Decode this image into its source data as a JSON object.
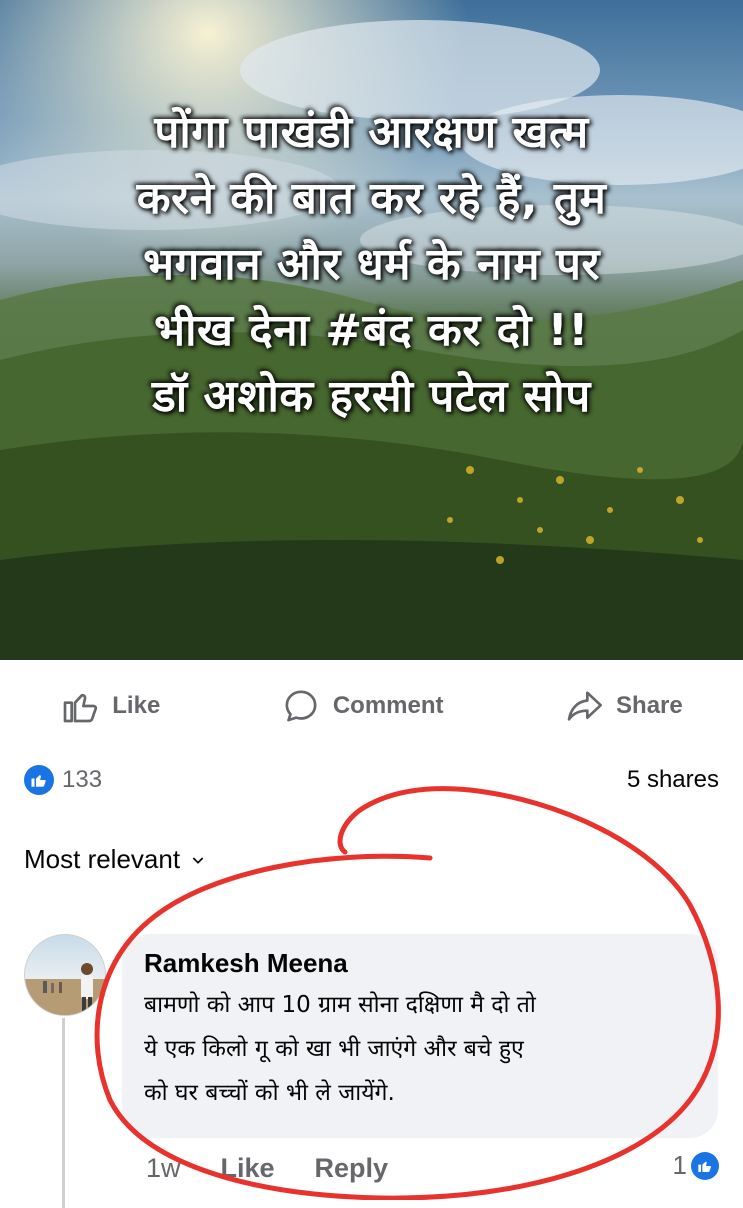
{
  "post": {
    "overlay_lines": [
      "पोंगा पाखंडी आरक्षण खत्म",
      "करने की बात कर रहे हैं, तुम",
      "भगवान और धर्म के नाम पर",
      "भीख  देना  #बंद  कर  दो  !!",
      "डॉ अशोक हरसी पटेल सोप"
    ]
  },
  "actions": {
    "like_label": "Like",
    "comment_label": "Comment",
    "share_label": "Share"
  },
  "stats": {
    "reaction_count": "133",
    "shares_text": "5 shares"
  },
  "comments": {
    "sort_label": "Most relevant",
    "items": [
      {
        "author": "Ramkesh Meena",
        "text_lines": [
          "बामणो को आप 10 ग्राम सोना दक्षिणा मै दो तो",
          "ये एक किलो गू को खा भी जाएंगे और बचे हुए",
          "को घर बच्चों को भी ले जायेंगे."
        ],
        "time": "1w",
        "like_label": "Like",
        "reply_label": "Reply",
        "like_count": "1"
      }
    ]
  },
  "colors": {
    "brand_blue": "#1b74e4",
    "secondary_text": "#65676b",
    "bubble_bg": "#f0f2f5",
    "annotation_red": "#e8322c"
  }
}
